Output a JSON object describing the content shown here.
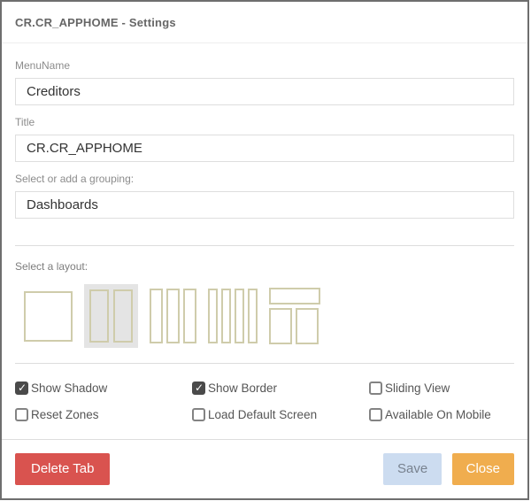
{
  "dialog": {
    "title": "CR.CR_APPHOME - Settings"
  },
  "fields": {
    "menu_name": {
      "label": "MenuName",
      "value": "Creditors"
    },
    "title": {
      "label": "Title",
      "value": "CR.CR_APPHOME"
    },
    "grouping": {
      "label": "Select or add a grouping:",
      "value": "Dashboards"
    }
  },
  "layout_section": {
    "label": "Select a layout:",
    "options": [
      {
        "name": "one-column",
        "selected": false
      },
      {
        "name": "two-columns",
        "selected": true
      },
      {
        "name": "three-columns",
        "selected": false
      },
      {
        "name": "four-columns",
        "selected": false
      },
      {
        "name": "header-with-two-columns",
        "selected": false
      }
    ]
  },
  "checkboxes": [
    {
      "label": "Show Shadow",
      "checked": true
    },
    {
      "label": "Show Border",
      "checked": true
    },
    {
      "label": "Sliding View",
      "checked": false
    },
    {
      "label": "Reset Zones",
      "checked": false
    },
    {
      "label": "Load Default Screen",
      "checked": false
    },
    {
      "label": "Available On Mobile",
      "checked": false
    }
  ],
  "footer": {
    "delete_label": "Delete Tab",
    "save_label": "Save",
    "close_label": "Close"
  },
  "colors": {
    "delete_button": "#d9534f",
    "save_button": "#ccdcf0",
    "save_button_text": "#78828f",
    "close_button": "#f0ad4e",
    "layout_border": "#cfccab",
    "selected_layout_bg": "#e4e4e4",
    "checkbox_checked": "#4a4a4a",
    "dialog_border": "#6e6e6e"
  }
}
